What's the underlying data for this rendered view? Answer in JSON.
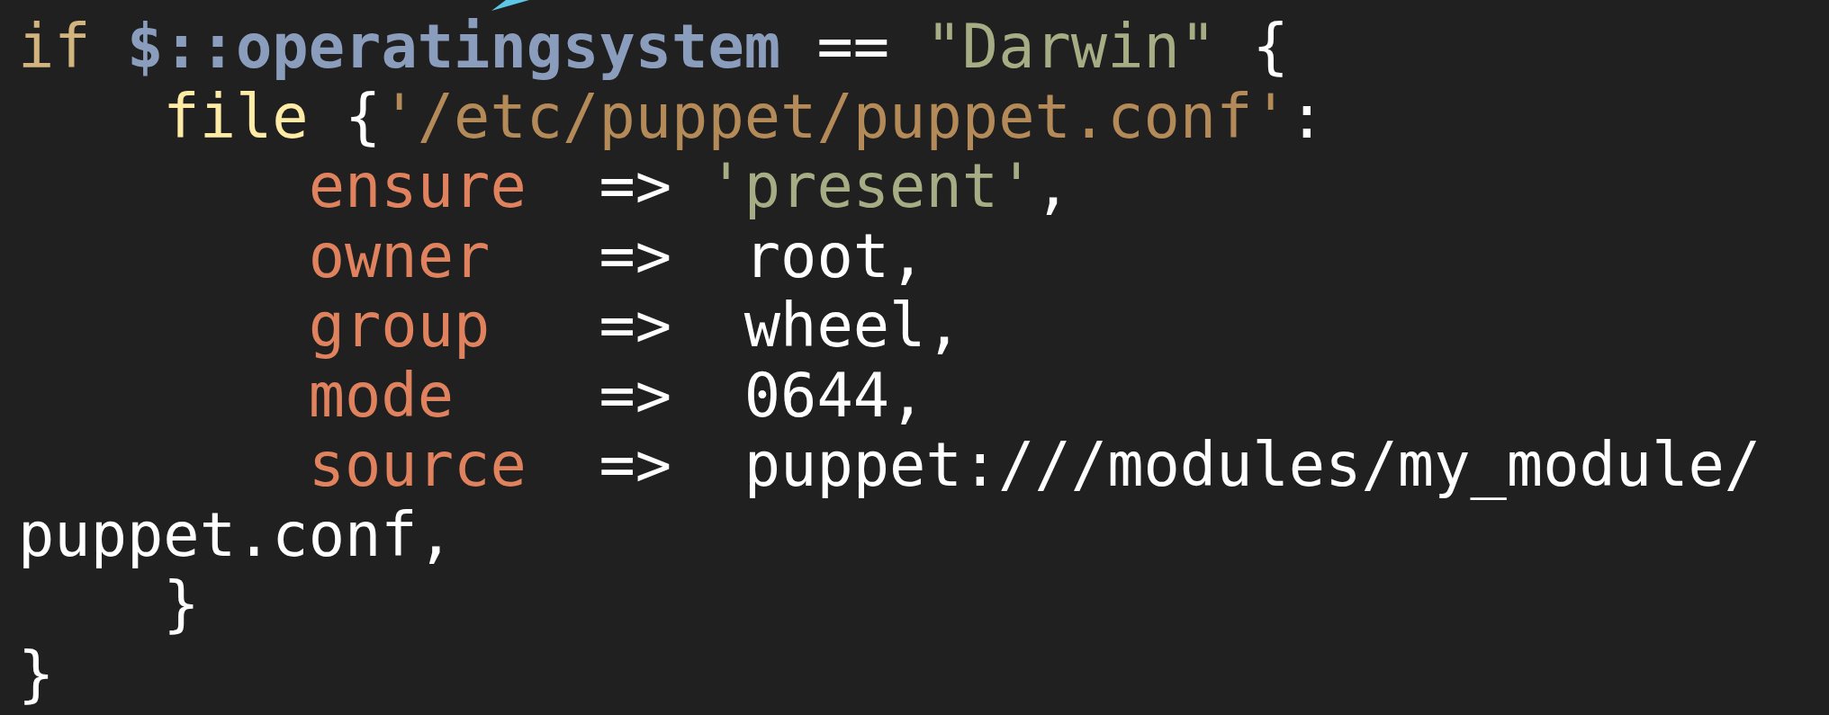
{
  "editor": {
    "lines": [
      {
        "tokens": [
          {
            "text": "if",
            "kind": "keyword"
          },
          {
            "text": " $::operatingsystem",
            "kind": "variable"
          },
          {
            "text": " == ",
            "kind": "plain"
          },
          {
            "text": "\"Darwin\"",
            "kind": "string"
          },
          {
            "text": " {",
            "kind": "plain"
          }
        ]
      },
      {
        "tokens": [
          {
            "text": "    file",
            "kind": "function"
          },
          {
            "text": " {",
            "kind": "plain"
          },
          {
            "text": "'/etc/puppet/puppet.conf'",
            "kind": "path"
          },
          {
            "text": ":",
            "kind": "plain"
          }
        ]
      },
      {
        "tokens": [
          {
            "text": "        ensure",
            "kind": "attribute"
          },
          {
            "text": "  => ",
            "kind": "plain"
          },
          {
            "text": "'present'",
            "kind": "string"
          },
          {
            "text": ",",
            "kind": "plain"
          }
        ]
      },
      {
        "tokens": [
          {
            "text": "        owner",
            "kind": "attribute"
          },
          {
            "text": "   =>  root,",
            "kind": "plain"
          }
        ]
      },
      {
        "tokens": [
          {
            "text": "        group",
            "kind": "attribute"
          },
          {
            "text": "   =>  wheel,",
            "kind": "plain"
          }
        ]
      },
      {
        "tokens": [
          {
            "text": "        mode",
            "kind": "attribute"
          },
          {
            "text": "    =>  0644,",
            "kind": "plain"
          }
        ]
      },
      {
        "tokens": [
          {
            "text": "        source",
            "kind": "attribute"
          },
          {
            "text": "  =>  puppet:///modules/my_module/",
            "kind": "plain"
          }
        ]
      },
      {
        "tokens": [
          {
            "text": "puppet.conf,",
            "kind": "plain"
          }
        ]
      },
      {
        "tokens": [
          {
            "text": "    }",
            "kind": "plain"
          }
        ]
      },
      {
        "tokens": [
          {
            "text": "}",
            "kind": "plain"
          }
        ]
      }
    ]
  }
}
